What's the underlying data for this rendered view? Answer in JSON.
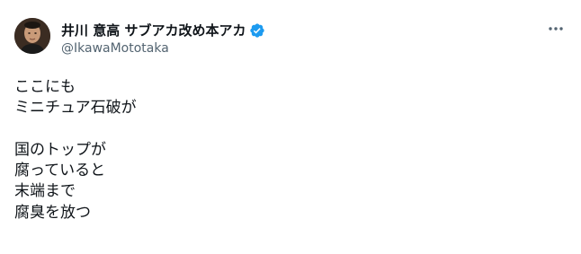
{
  "author": {
    "display_name": "井川 意高 サブアカ改め本アカ",
    "handle": "@IkawaMototaka",
    "verified": true,
    "avatar_icon": "avatar-photo"
  },
  "more_icon": "more-options-icon",
  "post": {
    "lines": [
      "ここにも",
      "ミニチュア石破が",
      "",
      "国のトップが",
      "腐っていると",
      "末端まで",
      "腐臭を放つ"
    ]
  },
  "colors": {
    "text": "#0f1419",
    "secondary": "#536471",
    "verified": "#1d9bf0"
  }
}
